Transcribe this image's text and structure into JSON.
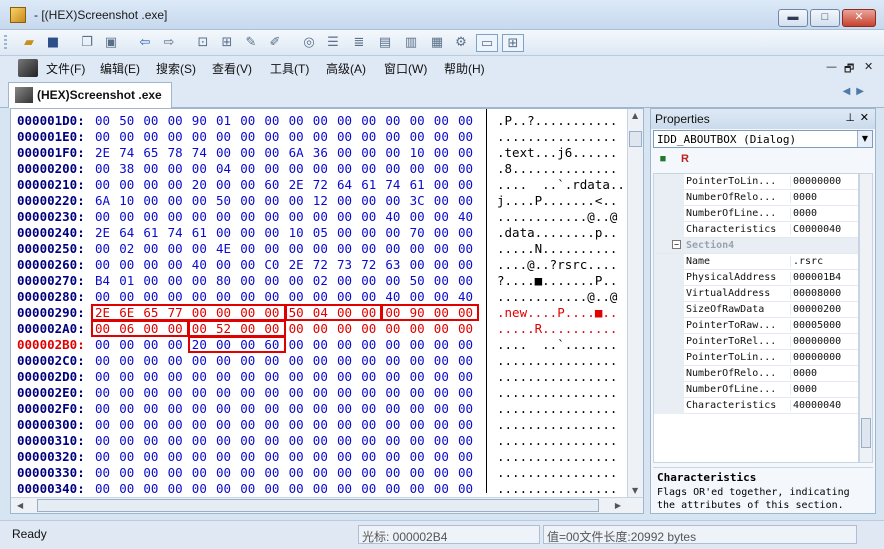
{
  "window": {
    "title": "- [(HEX)Screenshot .exe]",
    "minimize": "▬",
    "maximize": "□",
    "close": "✕"
  },
  "toolbar": {
    "icons": [
      "open-icon",
      "save-icon",
      "copy-icon",
      "paste-icon",
      "back-icon",
      "forward-icon",
      "tool-icon-1",
      "tool-icon-2",
      "tool-icon-3",
      "tool-icon-4",
      "tool-icon-5",
      "tool-icon-6",
      "tool-icon-7",
      "tool-icon-8",
      "tool-icon-9",
      "tool-icon-10",
      "view-single-icon",
      "view-split-icon"
    ]
  },
  "menu": {
    "items": [
      "文件(F)",
      "编辑(E)",
      "搜索(S)",
      "查看(V)",
      "工具(T)",
      "高级(A)",
      "窗口(W)",
      "帮助(H)"
    ],
    "mdi_minimize": "—",
    "mdi_restore": "🗗",
    "mdi_close": "✕"
  },
  "tab": {
    "label": "(HEX)Screenshot .exe",
    "arrows": "◀▶"
  },
  "hex": {
    "rows": [
      {
        "addr": "000001D0:",
        "bytes": [
          "00",
          "50",
          "00",
          "00",
          "90",
          "01",
          "00",
          "00",
          "00",
          "00",
          "00",
          "00",
          "00",
          "00",
          "00",
          "00"
        ],
        "ascii": ".P..?..........."
      },
      {
        "addr": "000001E0:",
        "bytes": [
          "00",
          "00",
          "00",
          "00",
          "00",
          "00",
          "00",
          "00",
          "00",
          "00",
          "00",
          "00",
          "00",
          "00",
          "00",
          "00"
        ],
        "ascii": "................"
      },
      {
        "addr": "000001F0:",
        "bytes": [
          "2E",
          "74",
          "65",
          "78",
          "74",
          "00",
          "00",
          "00",
          "6A",
          "36",
          "00",
          "00",
          "00",
          "10",
          "00",
          "00"
        ],
        "ascii": ".text...j6......"
      },
      {
        "addr": "00000200:",
        "bytes": [
          "00",
          "38",
          "00",
          "00",
          "00",
          "04",
          "00",
          "00",
          "00",
          "00",
          "00",
          "00",
          "00",
          "00",
          "00",
          "00"
        ],
        "ascii": ".8.............."
      },
      {
        "addr": "00000210:",
        "bytes": [
          "00",
          "00",
          "00",
          "00",
          "20",
          "00",
          "00",
          "60",
          "2E",
          "72",
          "64",
          "61",
          "74",
          "61",
          "00",
          "00"
        ],
        "ascii": "....  ..`.rdata.."
      },
      {
        "addr": "00000220:",
        "bytes": [
          "6A",
          "10",
          "00",
          "00",
          "00",
          "50",
          "00",
          "00",
          "00",
          "12",
          "00",
          "00",
          "00",
          "3C",
          "00",
          "00"
        ],
        "ascii": "j....P.......<.."
      },
      {
        "addr": "00000230:",
        "bytes": [
          "00",
          "00",
          "00",
          "00",
          "00",
          "00",
          "00",
          "00",
          "00",
          "00",
          "00",
          "00",
          "40",
          "00",
          "00",
          "40"
        ],
        "ascii": "............@..@"
      },
      {
        "addr": "00000240:",
        "bytes": [
          "2E",
          "64",
          "61",
          "74",
          "61",
          "00",
          "00",
          "00",
          "10",
          "05",
          "00",
          "00",
          "00",
          "70",
          "00",
          "00"
        ],
        "ascii": ".data........p.."
      },
      {
        "addr": "00000250:",
        "bytes": [
          "00",
          "02",
          "00",
          "00",
          "00",
          "4E",
          "00",
          "00",
          "00",
          "00",
          "00",
          "00",
          "00",
          "00",
          "00",
          "00"
        ],
        "ascii": ".....N.........."
      },
      {
        "addr": "00000260:",
        "bytes": [
          "00",
          "00",
          "00",
          "00",
          "40",
          "00",
          "00",
          "C0",
          "2E",
          "72",
          "73",
          "72",
          "63",
          "00",
          "00",
          "00"
        ],
        "ascii": "....@..?rsrc...."
      },
      {
        "addr": "00000270:",
        "bytes": [
          "B4",
          "01",
          "00",
          "00",
          "00",
          "80",
          "00",
          "00",
          "00",
          "02",
          "00",
          "00",
          "00",
          "50",
          "00",
          "00"
        ],
        "ascii": "?....■.......P.."
      },
      {
        "addr": "00000280:",
        "bytes": [
          "00",
          "00",
          "00",
          "00",
          "00",
          "00",
          "00",
          "00",
          "00",
          "00",
          "00",
          "00",
          "40",
          "00",
          "00",
          "40"
        ],
        "ascii": "............@..@"
      },
      {
        "addr": "00000290:",
        "bytes": [
          "2E",
          "6E",
          "65",
          "77",
          "00",
          "00",
          "00",
          "00",
          "50",
          "04",
          "00",
          "00",
          "00",
          "90",
          "00",
          "00"
        ],
        "ascii": ".new....P....■..",
        "highlight": true
      },
      {
        "addr": "000002A0:",
        "bytes": [
          "00",
          "06",
          "00",
          "00",
          "00",
          "52",
          "00",
          "00",
          "00",
          "00",
          "00",
          "00",
          "00",
          "00",
          "00",
          "00"
        ],
        "ascii": ".....R..........",
        "highlight": true
      },
      {
        "addr": "000002B0:",
        "bytes": [
          "00",
          "00",
          "00",
          "00",
          "20",
          "00",
          "00",
          "60",
          "00",
          "00",
          "00",
          "00",
          "00",
          "00",
          "00",
          "00"
        ],
        "ascii": "....  ..`.......",
        "current": true
      },
      {
        "addr": "000002C0:",
        "bytes": [
          "00",
          "00",
          "00",
          "00",
          "00",
          "00",
          "00",
          "00",
          "00",
          "00",
          "00",
          "00",
          "00",
          "00",
          "00",
          "00"
        ],
        "ascii": "................"
      },
      {
        "addr": "000002D0:",
        "bytes": [
          "00",
          "00",
          "00",
          "00",
          "00",
          "00",
          "00",
          "00",
          "00",
          "00",
          "00",
          "00",
          "00",
          "00",
          "00",
          "00"
        ],
        "ascii": "................"
      },
      {
        "addr": "000002E0:",
        "bytes": [
          "00",
          "00",
          "00",
          "00",
          "00",
          "00",
          "00",
          "00",
          "00",
          "00",
          "00",
          "00",
          "00",
          "00",
          "00",
          "00"
        ],
        "ascii": "................"
      },
      {
        "addr": "000002F0:",
        "bytes": [
          "00",
          "00",
          "00",
          "00",
          "00",
          "00",
          "00",
          "00",
          "00",
          "00",
          "00",
          "00",
          "00",
          "00",
          "00",
          "00"
        ],
        "ascii": "................"
      },
      {
        "addr": "00000300:",
        "bytes": [
          "00",
          "00",
          "00",
          "00",
          "00",
          "00",
          "00",
          "00",
          "00",
          "00",
          "00",
          "00",
          "00",
          "00",
          "00",
          "00"
        ],
        "ascii": "................"
      },
      {
        "addr": "00000310:",
        "bytes": [
          "00",
          "00",
          "00",
          "00",
          "00",
          "00",
          "00",
          "00",
          "00",
          "00",
          "00",
          "00",
          "00",
          "00",
          "00",
          "00"
        ],
        "ascii": "................"
      },
      {
        "addr": "00000320:",
        "bytes": [
          "00",
          "00",
          "00",
          "00",
          "00",
          "00",
          "00",
          "00",
          "00",
          "00",
          "00",
          "00",
          "00",
          "00",
          "00",
          "00"
        ],
        "ascii": "................"
      },
      {
        "addr": "00000330:",
        "bytes": [
          "00",
          "00",
          "00",
          "00",
          "00",
          "00",
          "00",
          "00",
          "00",
          "00",
          "00",
          "00",
          "00",
          "00",
          "00",
          "00"
        ],
        "ascii": "................"
      },
      {
        "addr": "00000340:",
        "bytes": [
          "00",
          "00",
          "00",
          "00",
          "00",
          "00",
          "00",
          "00",
          "00",
          "00",
          "00",
          "00",
          "00",
          "00",
          "00",
          "00"
        ],
        "ascii": "................"
      }
    ]
  },
  "properties": {
    "title": "Properties",
    "pin": "📌",
    "close": "✕",
    "object": "IDD_ABOUTBOX (Dialog)",
    "rows": [
      {
        "name": "PointerToLin...",
        "value": "00000000"
      },
      {
        "name": "NumberOfRelo...",
        "value": "0000"
      },
      {
        "name": "NumberOfLine...",
        "value": "0000"
      },
      {
        "name": "Characteristics",
        "value": "C0000040"
      },
      {
        "section": "Section4"
      },
      {
        "name": "Name",
        "value": ".rsrc"
      },
      {
        "name": "PhysicalAddress",
        "value": "000001B4"
      },
      {
        "name": "VirtualAddress",
        "value": "00008000"
      },
      {
        "name": "SizeOfRawData",
        "value": "00000200"
      },
      {
        "name": "PointerToRaw...",
        "value": "00005000"
      },
      {
        "name": "PointerToRel...",
        "value": "00000000"
      },
      {
        "name": "PointerToLin...",
        "value": "00000000"
      },
      {
        "name": "NumberOfRelo...",
        "value": "0000"
      },
      {
        "name": "NumberOfLine...",
        "value": "0000"
      },
      {
        "name": "Characteristics",
        "value": "40000040"
      }
    ],
    "desc_title": "Characteristics",
    "desc_text": "Flags OR'ed together, indicating the attributes of this section."
  },
  "status": {
    "ready": "Ready",
    "cursor": "光标: 000002B4",
    "value": "值=00文件长度:20992 bytes"
  }
}
